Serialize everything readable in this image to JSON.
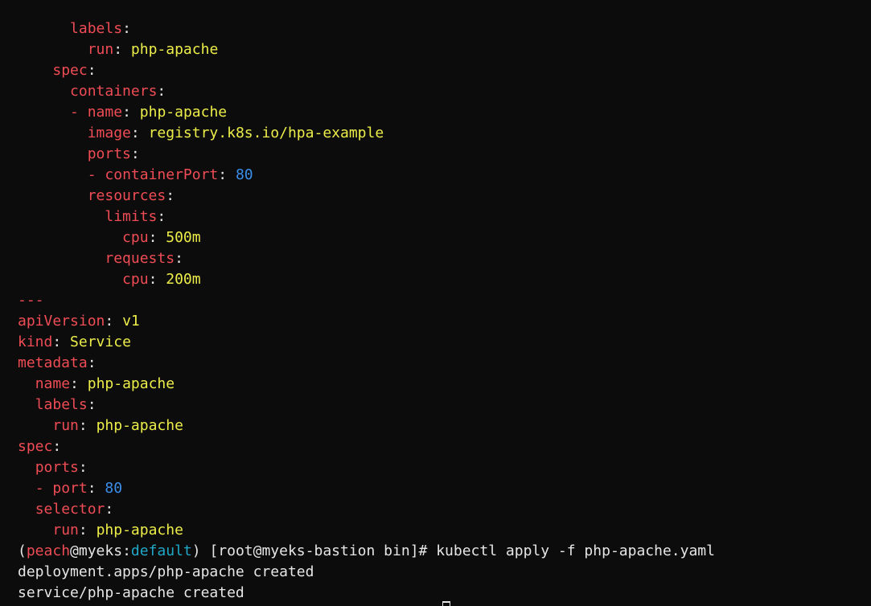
{
  "terminal": {
    "lines": [
      {
        "indent": "      ",
        "key": "labels",
        "value": ""
      },
      {
        "indent": "        ",
        "key": "run",
        "value": "php-apache"
      },
      {
        "indent": "    ",
        "key": "spec",
        "value": ""
      },
      {
        "indent": "      ",
        "key": "containers",
        "value": ""
      },
      {
        "indent": "      ",
        "dash": "- ",
        "key": "name",
        "value": "php-apache"
      },
      {
        "indent": "        ",
        "key": "image",
        "value": "registry.k8s.io/hpa-example"
      },
      {
        "indent": "        ",
        "key": "ports",
        "value": ""
      },
      {
        "indent": "        ",
        "dash": "- ",
        "key": "containerPort",
        "value": "80",
        "numeric": true
      },
      {
        "indent": "        ",
        "key": "resources",
        "value": ""
      },
      {
        "indent": "          ",
        "key": "limits",
        "value": ""
      },
      {
        "indent": "            ",
        "key": "cpu",
        "value": "500m"
      },
      {
        "indent": "          ",
        "key": "requests",
        "value": ""
      },
      {
        "indent": "            ",
        "key": "cpu",
        "value": "200m"
      },
      {
        "separator": "---"
      },
      {
        "indent": "",
        "key": "apiVersion",
        "value": "v1"
      },
      {
        "indent": "",
        "key": "kind",
        "value": "Service"
      },
      {
        "indent": "",
        "key": "metadata",
        "value": ""
      },
      {
        "indent": "  ",
        "key": "name",
        "value": "php-apache"
      },
      {
        "indent": "  ",
        "key": "labels",
        "value": ""
      },
      {
        "indent": "    ",
        "key": "run",
        "value": "php-apache"
      },
      {
        "indent": "",
        "key": "spec",
        "value": ""
      },
      {
        "indent": "  ",
        "key": "ports",
        "value": ""
      },
      {
        "indent": "  ",
        "dash": "- ",
        "key": "port",
        "value": "80",
        "numeric": true
      },
      {
        "indent": "  ",
        "key": "selector",
        "value": ""
      },
      {
        "indent": "    ",
        "key": "run",
        "value": "php-apache"
      }
    ],
    "prompt": {
      "open": "(",
      "user": "peach",
      "at": "@",
      "cluster": "myeks",
      "colon": ":",
      "namespace": "default",
      "rest": ") [root@myeks-bastion bin]# ",
      "command": "kubectl apply -f php-apache.yaml"
    },
    "output": [
      "deployment.apps/php-apache created",
      "service/php-apache created"
    ]
  },
  "colors": {
    "background": "#0c0c0c",
    "key": "#ef4c55",
    "string": "#eded4a",
    "number": "#3b8eea",
    "namespace": "#20a8c9",
    "text": "#e6e6e6"
  }
}
